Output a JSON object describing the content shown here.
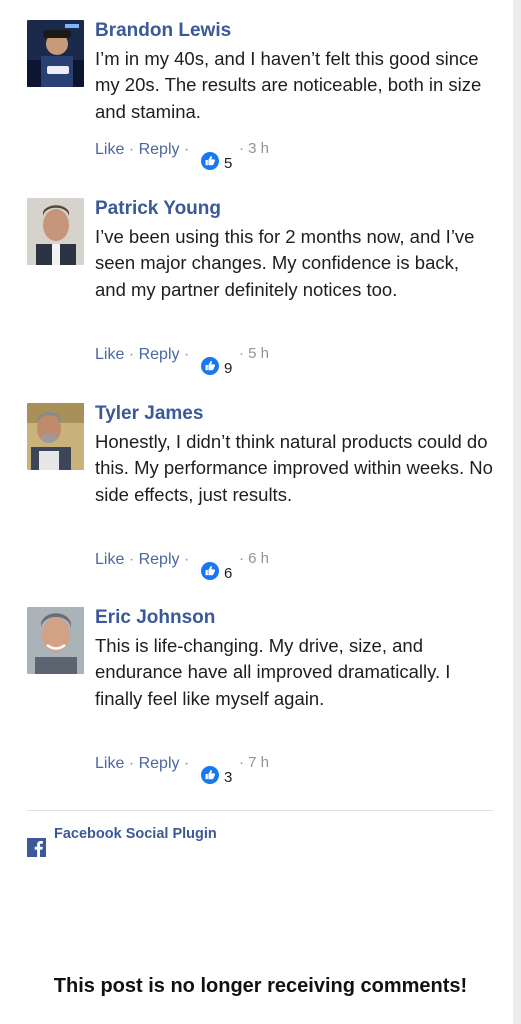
{
  "comments": [
    {
      "author": "Brandon Lewis",
      "text": "I’m in my 40s, and I haven’t felt this good since my 20s. The results are noticeable, both in size and stamina.",
      "like_label": "Like",
      "reply_label": "Reply",
      "likes": "5",
      "time": "3 h"
    },
    {
      "author": "Patrick Young",
      "text": "I’ve been using this for 2 months now, and I’ve seen major changes. My confidence is back, and my partner definitely notices too.",
      "like_label": "Like",
      "reply_label": "Reply",
      "likes": "9",
      "time": "5 h"
    },
    {
      "author": "Tyler James",
      "text": "Honestly, I didn’t think natural products could do this. My performance improved within weeks. No side effects, just results.",
      "like_label": "Like",
      "reply_label": "Reply",
      "likes": "6",
      "time": "6 h"
    },
    {
      "author": "Eric Johnson",
      "text": "This is life-changing. My drive, size, and endurance have all improved dramatically. I finally feel like myself again.",
      "like_label": "Like",
      "reply_label": "Reply",
      "likes": "3",
      "time": "7 h"
    }
  ],
  "separator": "·",
  "footer": {
    "plugin_label": "Facebook Social Plugin",
    "closed_message": "This post is no longer receiving comments!"
  },
  "colors": {
    "author_blue": "#3b5998",
    "link_blue": "#4b67a1",
    "like_badge_blue": "#1877f2",
    "meta_gray": "#90949c"
  }
}
